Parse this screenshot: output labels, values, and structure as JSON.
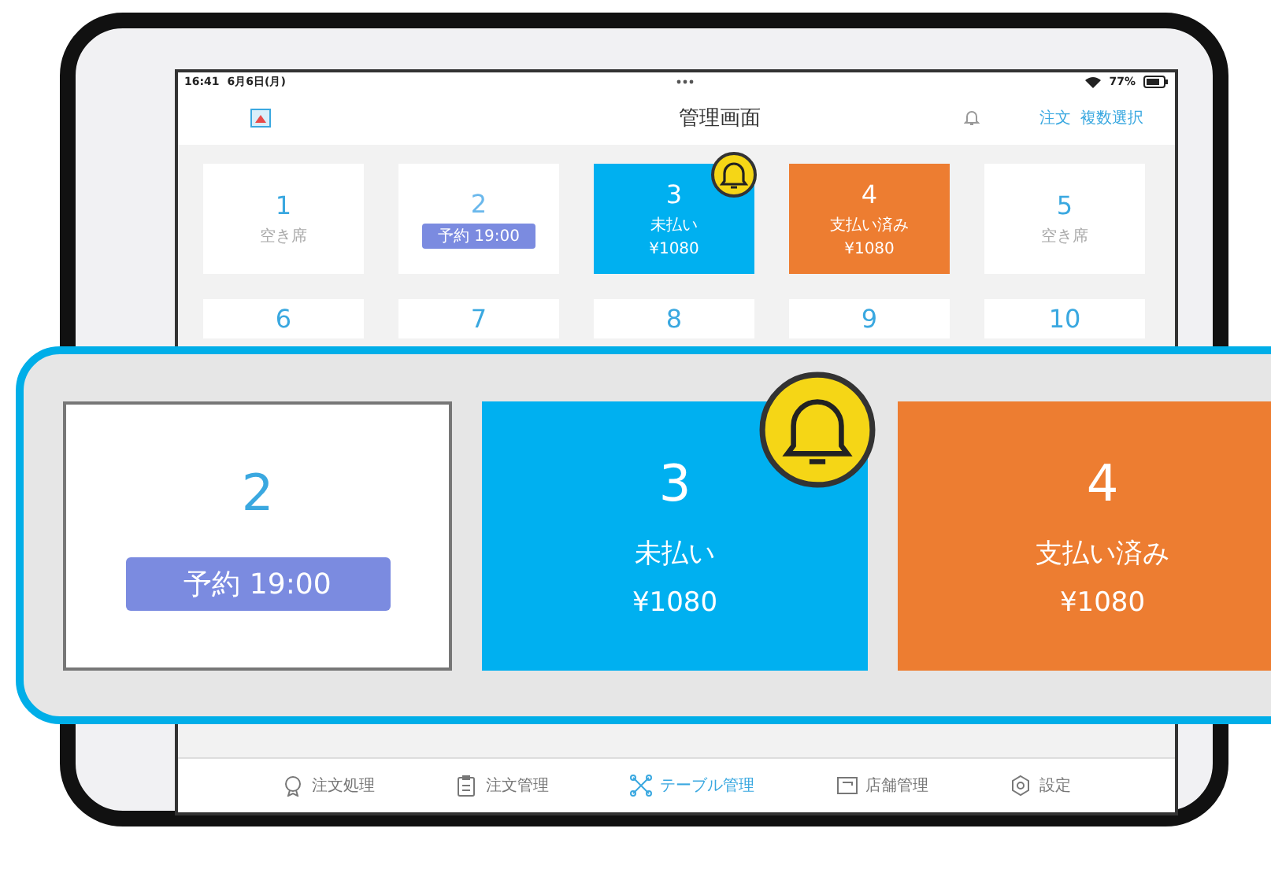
{
  "status_bar": {
    "time": "16:41",
    "date": "6月6日(月)",
    "battery": "77%"
  },
  "nav": {
    "title": "管理画面",
    "actions": [
      "注文",
      "複数選択"
    ]
  },
  "tables": [
    {
      "number": "1",
      "kind": "empty",
      "label": "空き席"
    },
    {
      "number": "2",
      "kind": "reserved",
      "reservation": "予約 19:00"
    },
    {
      "number": "3",
      "kind": "unpaid",
      "label": "未払い",
      "price": "¥1080",
      "alert": true
    },
    {
      "number": "4",
      "kind": "paid",
      "label": "支払い済み",
      "price": "¥1080"
    },
    {
      "number": "5",
      "kind": "empty",
      "label": "空き席"
    },
    {
      "number": "6",
      "kind": "empty"
    },
    {
      "number": "7",
      "kind": "empty"
    },
    {
      "number": "8",
      "kind": "empty"
    },
    {
      "number": "9",
      "kind": "empty"
    },
    {
      "number": "10",
      "kind": "empty"
    }
  ],
  "tab_bar": [
    {
      "label": "注文処理",
      "selected": false
    },
    {
      "label": "注文管理",
      "selected": false
    },
    {
      "label": "テーブル管理",
      "selected": true
    },
    {
      "label": "店舗管理",
      "selected": false
    },
    {
      "label": "設定",
      "selected": false
    }
  ],
  "callout": {
    "tables": [
      {
        "number": "2",
        "kind": "reserved",
        "reservation": "予約 19:00"
      },
      {
        "number": "3",
        "kind": "unpaid",
        "label": "未払い",
        "price": "¥1080",
        "alert": true
      },
      {
        "number": "4",
        "kind": "paid",
        "label": "支払い済み",
        "price": "¥1080"
      }
    ]
  }
}
